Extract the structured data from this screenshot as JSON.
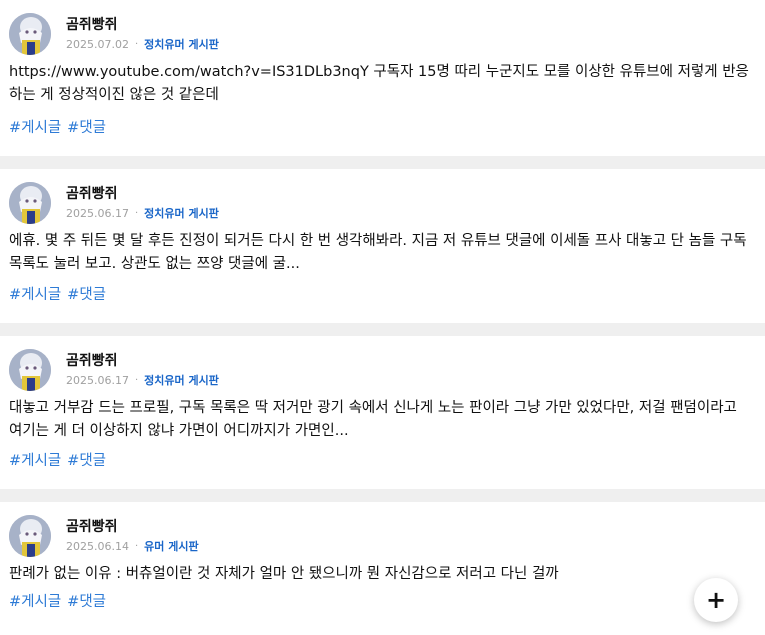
{
  "posts": [
    {
      "author": "곰쥐빵쥐",
      "date": "2025.07.02",
      "separator": "·",
      "board": "정치유머 게시판",
      "content": "https://www.youtube.com/watch?v=IS31DLb3nqY 구독자 15명 따리 누군지도 모를 이상한 유튜브에 저렇게 반응하는 게 정상적이진 않은 것 같은데",
      "tags": [
        "#게시글",
        "#댓글"
      ]
    },
    {
      "author": "곰쥐빵쥐",
      "date": "2025.06.17",
      "separator": "·",
      "board": "정치유머 게시판",
      "content": "에휴. 몇 주 뒤든 몇 달 후든 진정이 되거든 다시 한 번 생각해봐라. 지금 저 유튜브 댓글에 이세돌 프사 대놓고 단 놈들 구독 목록도 눌러 보고. 상관도 없는 쯔양 댓글에 굴...",
      "tags": [
        "#게시글",
        "#댓글"
      ]
    },
    {
      "author": "곰쥐빵쥐",
      "date": "2025.06.17",
      "separator": "·",
      "board": "정치유머 게시판",
      "content": "대놓고 거부감 드는 프로필, 구독 목록은 딱 저거만 광기 속에서 신나게 노는 판이라 그냥 가만 있었다만, 저걸 팬덤이라고 여기는 게 더 이상하지 않냐 가면이 어디까지가 가면인...",
      "tags": [
        "#게시글",
        "#댓글"
      ]
    },
    {
      "author": "곰쥐빵쥐",
      "date": "2025.06.14",
      "separator": "·",
      "board": "유머 게시판",
      "content": "판례가 없는 이유 : 버츄얼이란 것 자체가 얼마 안 됐으니까 뭔 자신감으로 저러고 다닌 걸까",
      "tags": [
        "#게시글",
        "#댓글"
      ]
    }
  ],
  "fab": {
    "icon": "plus-icon",
    "label": "+"
  },
  "colors": {
    "accent": "#1a66c8",
    "tag": "#2e7bd6",
    "date": "#a0a0a0",
    "background": "#efefef"
  }
}
